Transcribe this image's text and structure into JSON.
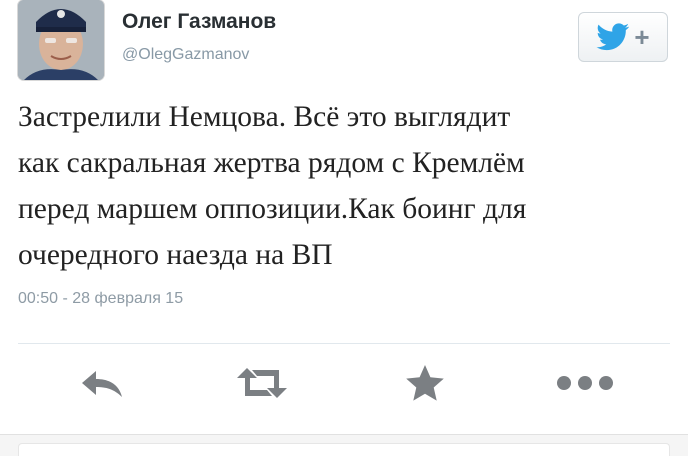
{
  "tweet": {
    "author": {
      "display_name": "Олег Газманов",
      "handle": "@OlegGazmanov",
      "avatar_icon": "profile-photo"
    },
    "follow_button": {
      "icon": "twitter-bird-icon",
      "plus": "+"
    },
    "text_lines": [
      "Застрелили Немцова. Всё это выглядит",
      "как сакральная жертва рядом с Кремлём",
      "перед маршем оппозиции.Как боинг для",
      "очередного наезда на ВП"
    ],
    "timestamp": "00:50 - 28 февраля 15"
  },
  "actions": [
    {
      "icon": "reply-icon"
    },
    {
      "icon": "retweet-icon"
    },
    {
      "icon": "favorite-star-icon"
    },
    {
      "icon": "more-dots-icon"
    }
  ],
  "colors": {
    "icon_gray": "#7b7f83",
    "twitter_blue": "#2fa4e7",
    "text": "#222222",
    "meta": "#8e9ba5"
  }
}
